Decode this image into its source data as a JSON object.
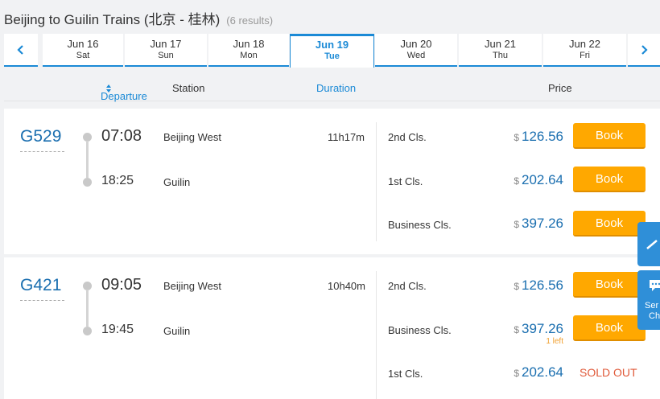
{
  "title": {
    "main": "Beijing to Guilin Trains (北京 - 桂林)",
    "count": "(6 results)"
  },
  "dates": [
    {
      "date": "Jun 16",
      "weekday": "Sat",
      "active": false
    },
    {
      "date": "Jun 17",
      "weekday": "Sun",
      "active": false
    },
    {
      "date": "Jun 18",
      "weekday": "Mon",
      "active": false
    },
    {
      "date": "Jun 19",
      "weekday": "Tue",
      "active": true
    },
    {
      "date": "Jun 20",
      "weekday": "Wed",
      "active": false
    },
    {
      "date": "Jun 21",
      "weekday": "Thu",
      "active": false
    },
    {
      "date": "Jun 22",
      "weekday": "Fri",
      "active": false
    }
  ],
  "columns": {
    "departure": "Departure",
    "station": "Station",
    "duration": "Duration",
    "price": "Price"
  },
  "trains": [
    {
      "number": "G529",
      "depart_time": "07:08",
      "arrive_time": "18:25",
      "depart_station": "Beijing West",
      "arrive_station": "Guilin",
      "duration": "11h17m",
      "seats": [
        {
          "class": "2nd Cls.",
          "currency": "$",
          "price": "126.56",
          "action": "Book",
          "note": ""
        },
        {
          "class": "1st Cls.",
          "currency": "$",
          "price": "202.64",
          "action": "Book",
          "note": ""
        },
        {
          "class": "Business Cls.",
          "currency": "$",
          "price": "397.26",
          "action": "Book",
          "note": ""
        }
      ]
    },
    {
      "number": "G421",
      "depart_time": "09:05",
      "arrive_time": "19:45",
      "depart_station": "Beijing West",
      "arrive_station": "Guilin",
      "duration": "10h40m",
      "seats": [
        {
          "class": "2nd Cls.",
          "currency": "$",
          "price": "126.56",
          "action": "Book",
          "note": ""
        },
        {
          "class": "Business Cls.",
          "currency": "$",
          "price": "397.26",
          "action": "Book",
          "note": "1 left"
        },
        {
          "class": "1st Cls.",
          "currency": "$",
          "price": "202.64",
          "action": "SOLD OUT",
          "note": ""
        }
      ]
    }
  ],
  "floating": {
    "chat_line1": "Ser",
    "chat_line2": "Ch"
  },
  "colors": {
    "accent": "#1b8ad6",
    "book": "#ffa800",
    "sold_out": "#e05a3a"
  },
  "icons": {
    "prev": "chevron-left-icon",
    "next": "chevron-right-icon",
    "sort": "sort-icon",
    "scroll_top": "arrow-up-icon",
    "chat": "chat-icon"
  }
}
